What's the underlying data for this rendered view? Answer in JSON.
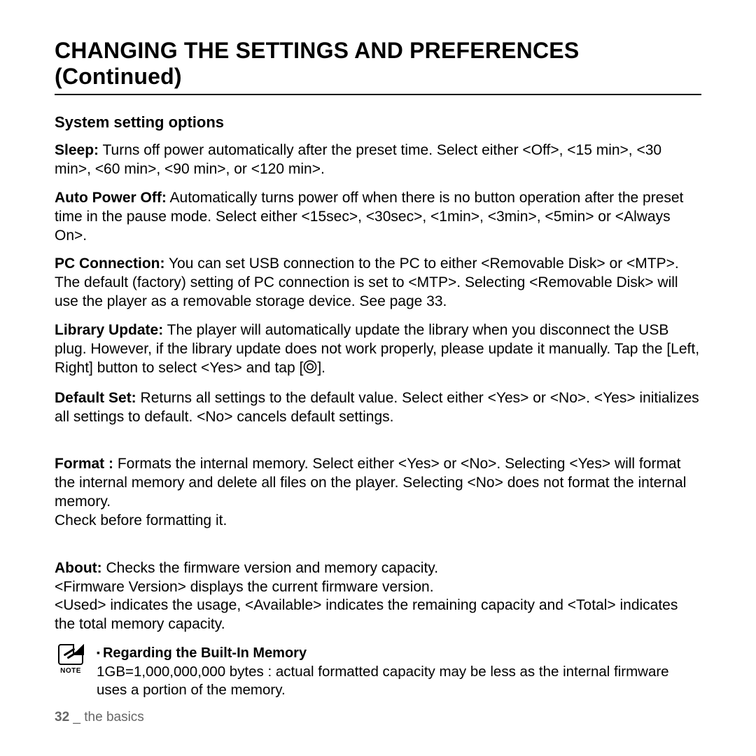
{
  "title": "CHANGING THE SETTINGS AND PREFERENCES (Continued)",
  "subtitle": "System setting options",
  "items": {
    "sleep_term": "Sleep:",
    "sleep_text": " Turns off power automatically after the preset time. Select either <Off>, <15 min>, <30 min>, <60 min>, <90 min>, or <120 min>.",
    "apo_term": "Auto Power Off:",
    "apo_text": " Automatically turns power off when there is no button operation after the preset time in the pause mode. Select either <15sec>, <30sec>, <1min>, <3min>, <5min> or <Always On>.",
    "pc_term": "PC Connection:",
    "pc_text": " You can set USB connection to the PC to either <Removable Disk> or <MTP>. The default (factory) setting of PC connection is set to <MTP>. Selecting <Removable Disk> will use the player as a removable storage device. See page 33.",
    "lib_term": "Library Update:",
    "lib_text_a": " The player will  automatically update the library when you disconnect the USB plug. However, if the library update does not work properly, please update it manually. Tap the [Left, Right] button to select <Yes> and tap [",
    "lib_text_b": "].",
    "def_term": "Default Set:",
    "def_text": " Returns all settings to the default value. Select either <Yes> or <No>. <Yes> initializes all settings to default. <No> cancels default settings.",
    "fmt_term": "Format :",
    "fmt_text": " Formats the internal memory. Select either <Yes> or <No>. Selecting <Yes> will format the internal memory and delete all files on the player. Selecting <No> does not format the internal memory.\nCheck before formatting it.",
    "about_term": "About:",
    "about_text": " Checks the firmware version and memory capacity.\n<Firmware Version> displays the current firmware version.\n<Used> indicates the usage, <Available> indicates the remaining capacity and <Total> indicates the total memory capacity."
  },
  "note": {
    "label": "NOTE",
    "heading": "Regarding the Built-In Memory",
    "text": "1GB=1,000,000,000 bytes : actual formatted capacity may be less as the internal firmware uses a portion of the memory."
  },
  "footer": {
    "page": "32",
    "sep": " _ ",
    "section": "the basics"
  }
}
